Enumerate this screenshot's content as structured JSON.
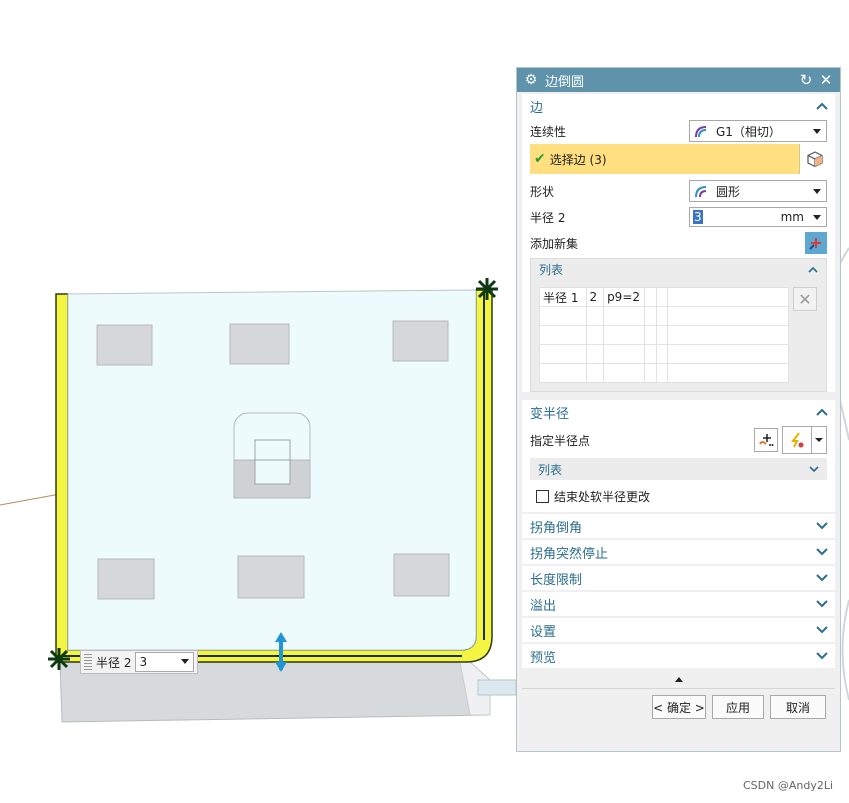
{
  "dialog": {
    "title": "边倒圆",
    "edge_section": {
      "title": "边",
      "continuity_label": "连续性",
      "continuity_value": "G1（相切）",
      "select_edge_label": "选择边 (3)",
      "shape_label": "形状",
      "shape_value": "圆形",
      "radius_label": "半径 2",
      "radius_value": "3",
      "radius_unit": "mm",
      "add_new_set_label": "添加新集",
      "list": {
        "title": "列表",
        "rows": [
          [
            "半径 1",
            "2",
            "p9=2",
            "",
            "",
            ""
          ],
          [
            "",
            "",
            "",
            "",
            "",
            ""
          ],
          [
            "",
            "",
            "",
            "",
            "",
            ""
          ],
          [
            "",
            "",
            "",
            "",
            "",
            ""
          ],
          [
            "",
            "",
            "",
            "",
            "",
            ""
          ]
        ]
      }
    },
    "variable_radius_section": {
      "title": "变半径",
      "specify_point_label": "指定半径点",
      "list_title": "列表",
      "checkbox_label": "结束处软半径更改"
    },
    "collapsed_sections": [
      "拐角倒角",
      "拐角突然停止",
      "长度限制",
      "溢出",
      "设置",
      "预览"
    ],
    "buttons": {
      "ok": "< 确定 >",
      "apply": "应用",
      "cancel": "取消"
    }
  },
  "viewport": {
    "radius_tag_label": "半径 2",
    "radius_tag_value": "3"
  },
  "watermark": "CSDN @Andy2Li",
  "colors": {
    "titlebar": "#5e93ab",
    "section_header_text": "#2c6e8e",
    "selection_highlight": "#ffdf7f",
    "edge_highlight": "#f3f542",
    "plate_face": "#eefbfd"
  }
}
